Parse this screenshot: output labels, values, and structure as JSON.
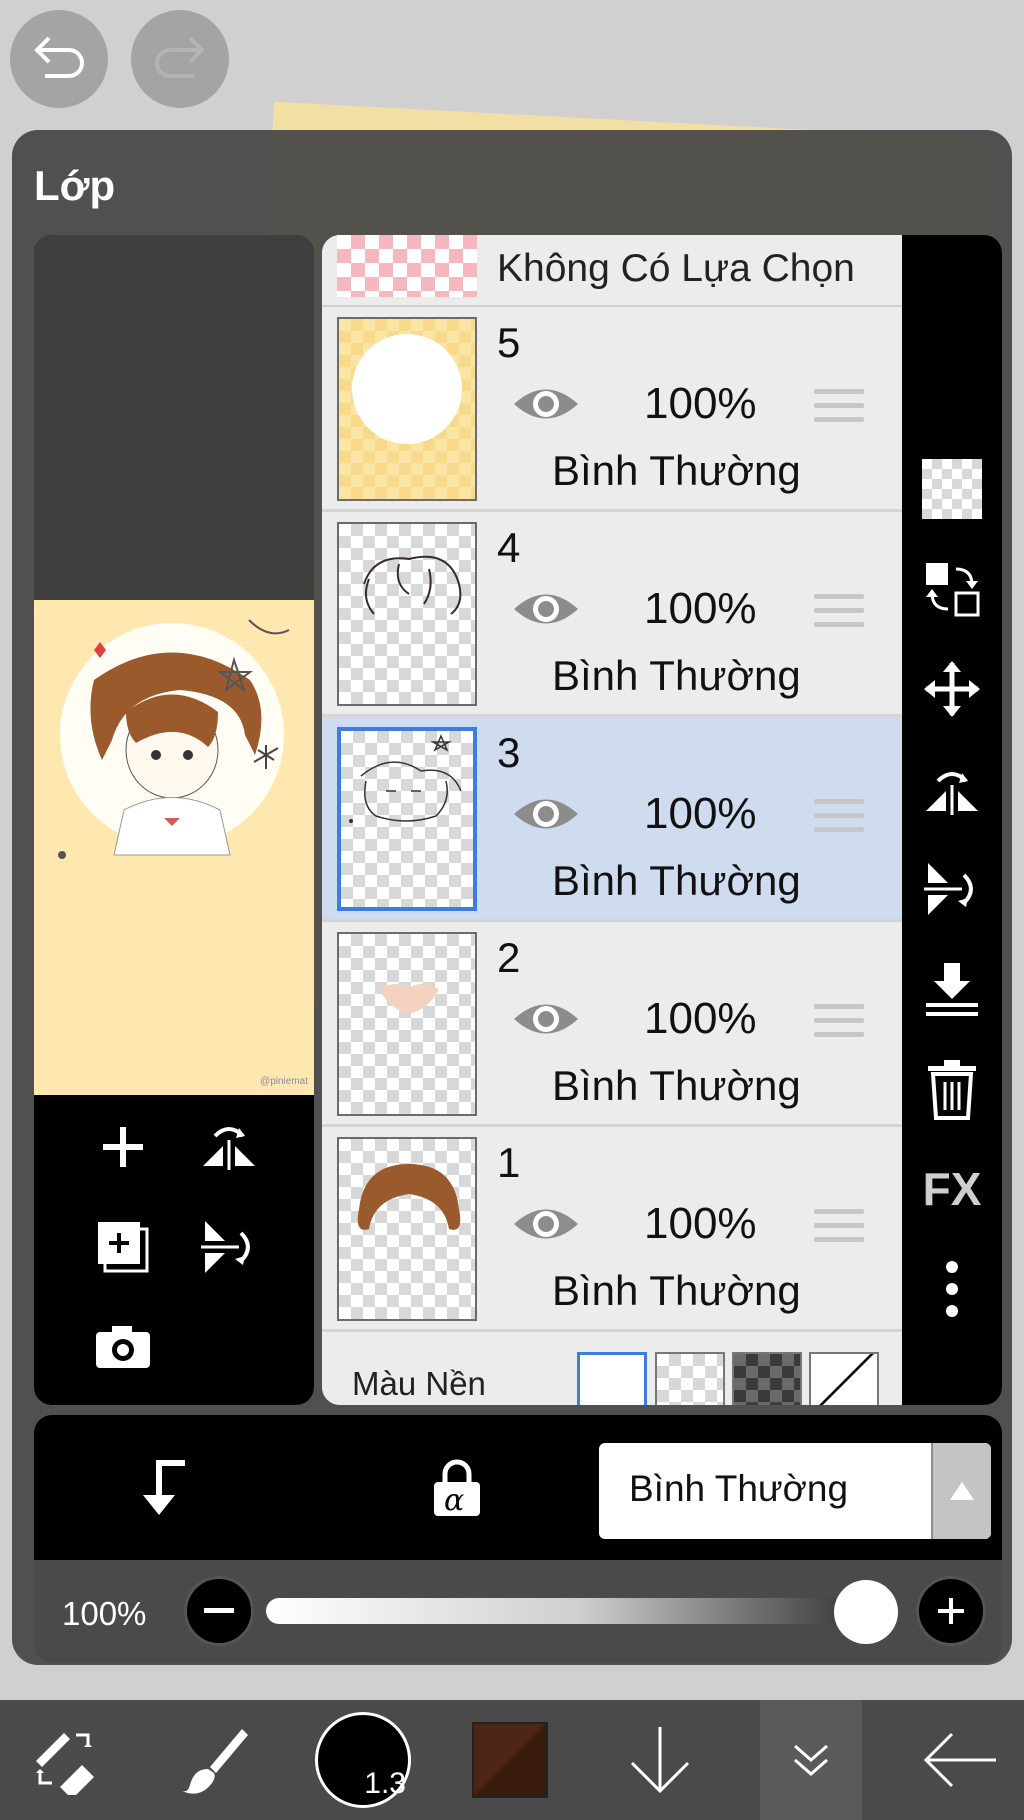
{
  "top": {
    "undo_icon": "undo-arrow-icon",
    "redo_icon": "redo-arrow-icon"
  },
  "panel": {
    "title": "Lớp"
  },
  "layers_panel": {
    "selection_label": "Không Có Lựa Chọn",
    "layers": [
      {
        "number": "5",
        "opacity": "100%",
        "mode": "Bình Thường",
        "visible": true,
        "selected": false
      },
      {
        "number": "4",
        "opacity": "100%",
        "mode": "Bình Thường",
        "visible": true,
        "selected": false
      },
      {
        "number": "3",
        "opacity": "100%",
        "mode": "Bình Thường",
        "visible": true,
        "selected": true
      },
      {
        "number": "2",
        "opacity": "100%",
        "mode": "Bình Thường",
        "visible": true,
        "selected": false
      },
      {
        "number": "1",
        "opacity": "100%",
        "mode": "Bình Thường",
        "visible": true,
        "selected": false
      }
    ],
    "background_label": "Màu Nền"
  },
  "side_tools": {
    "fx_label": "FX"
  },
  "blend": {
    "mode": "Bình Thường",
    "alpha_lock_symbol": "α"
  },
  "opacity_control": {
    "label": "100%",
    "value": 1.0
  },
  "bottom_toolbar": {
    "brush_size": "1.3",
    "current_color": "#4e2414"
  },
  "preview": {
    "signature": "@piniemat"
  },
  "colors": {
    "selected_layer_bg": "#cfdcef",
    "selection_border": "#3c7de0",
    "panel_bg": "#444444"
  }
}
